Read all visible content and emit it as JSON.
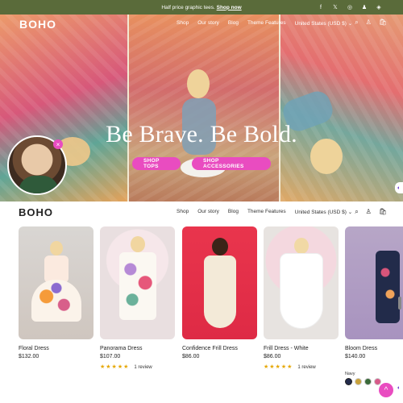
{
  "announcement": {
    "text": "Half price graphic tees. ",
    "link": "Shop now"
  },
  "socials": [
    "f",
    "𝕏",
    "◎",
    "♟",
    "◈"
  ],
  "brand": {
    "logo": "BOHO",
    "accent": "#e94cc0",
    "bar_color": "#5a6b3a"
  },
  "nav": [
    "Shop",
    "Our story",
    "Blog",
    "Theme Features",
    "United States (USD $) ⌄"
  ],
  "tools": {
    "search": "⌕",
    "account": "♙",
    "cart": "🛍"
  },
  "hero": {
    "title": "Be Brave. Be Bold.",
    "buttons": [
      "SHOP TOPS",
      "SHOP ACCESSORIES"
    ]
  },
  "bubble": {
    "close": "×"
  },
  "products": [
    {
      "name": "Floral Dress",
      "price": "$132.00"
    },
    {
      "name": "Panorama Dress",
      "price": "$107.00",
      "stars": "★★★★★",
      "reviews": "1 review"
    },
    {
      "name": "Confidence Frill Dress",
      "price": "$86.00"
    },
    {
      "name": "Frill Dress - White",
      "price": "$86.00",
      "stars": "★★★★★",
      "reviews": "1 review"
    },
    {
      "name": "Bloom Dress",
      "price": "$140.00",
      "swatch_label": "Navy"
    }
  ],
  "chat": {
    "icon": "^"
  }
}
